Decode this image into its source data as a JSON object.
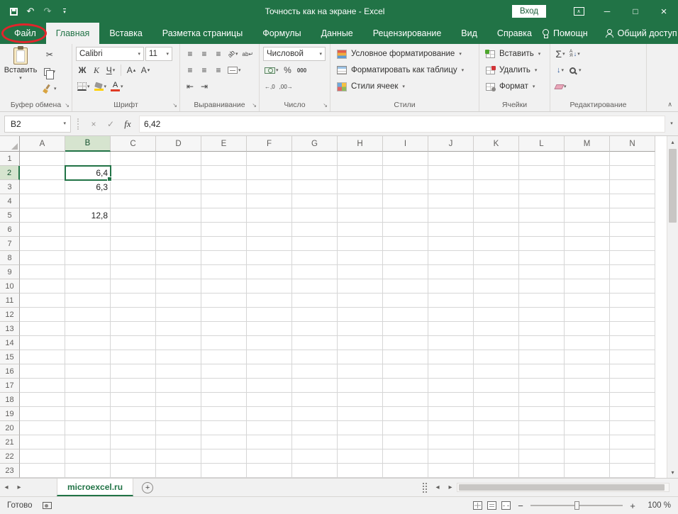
{
  "colors": {
    "excel_green": "#217346",
    "ribbon_bg": "#f1f1f1",
    "annotation_red": "#e3242b",
    "header_highlight": "#d6e4cf",
    "selection_border": "#217346"
  },
  "titlebar": {
    "title": "Точность как на экране - Excel",
    "sign_in": "Вход"
  },
  "ribbon_tabs": [
    {
      "id": "file",
      "label": "Файл",
      "file": true
    },
    {
      "id": "home",
      "label": "Главная",
      "active": true
    },
    {
      "id": "insert",
      "label": "Вставка"
    },
    {
      "id": "page-layout",
      "label": "Разметка страницы"
    },
    {
      "id": "formulas",
      "label": "Формулы"
    },
    {
      "id": "data",
      "label": "Данные"
    },
    {
      "id": "review",
      "label": "Рецензирование"
    },
    {
      "id": "view",
      "label": "Вид"
    },
    {
      "id": "help",
      "label": "Справка"
    }
  ],
  "tab_extras": {
    "assistant": "Помощн",
    "share": "Общий доступ"
  },
  "ribbon": {
    "clipboard": {
      "label": "Буфер обмена",
      "paste": "Вставить"
    },
    "font": {
      "label": "Шрифт",
      "name": "Calibri",
      "size": "11",
      "bold": "Ж",
      "italic": "К",
      "underline": "Ч",
      "letter": "А"
    },
    "alignment": {
      "label": "Выравнивание"
    },
    "number": {
      "label": "Число",
      "format": "Числовой",
      "percent": "%",
      "thousands": "000",
      "inc_decimal": "←,0",
      "dec_decimal": ",00→"
    },
    "styles": {
      "label": "Стили",
      "items": [
        "Условное форматирование",
        "Форматировать как таблицу",
        "Стили ячеек"
      ]
    },
    "cells": {
      "label": "Ячейки",
      "items": [
        "Вставить",
        "Удалить",
        "Формат"
      ]
    },
    "editing": {
      "label": "Редактирование",
      "autosum": "Σ",
      "sort_top": "А",
      "sort_bottom": "Я"
    }
  },
  "formula_bar": {
    "name_box": "B2",
    "fx": "fx",
    "value": "6,42"
  },
  "grid": {
    "columns": [
      "A",
      "B",
      "C",
      "D",
      "E",
      "F",
      "G",
      "H",
      "I",
      "J",
      "K",
      "L",
      "M",
      "N"
    ],
    "row_count": 23,
    "selected_cell": "B2",
    "selected_column": "B",
    "selected_row": 2,
    "cells": {
      "B2": "6,4",
      "B3": "6,3",
      "B5": "12,8"
    }
  },
  "sheet_bar": {
    "active_tab": "microexcel.ru"
  },
  "status_bar": {
    "mode": "Готово",
    "zoom": "100 %"
  },
  "icons": {
    "caret": "▾",
    "up": "▴",
    "down": "▾",
    "left": "◂",
    "right": "▸",
    "undo": "↶",
    "redo": "↷",
    "cut": "✂",
    "check": "✓",
    "cancel": "×",
    "align": "≡",
    "indent_left": "⇤",
    "indent_right": "⇥",
    "orientation": "ab",
    "wrap": "ab↵",
    "down_arrow": "↓",
    "collapse": "∧",
    "launcher": "↘",
    "plus": "+",
    "minus": "−",
    "minimize": "─",
    "maximize": "□",
    "close": "×"
  }
}
